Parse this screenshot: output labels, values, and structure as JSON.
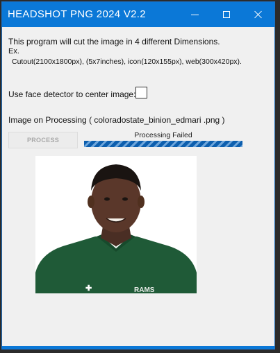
{
  "window": {
    "title": "HEADSHOT PNG 2024 V2.2",
    "accent_color": "#0b78d7",
    "controls": [
      "minimize-icon",
      "maximize-icon",
      "close-icon"
    ]
  },
  "info": {
    "line1": "This program will cut the image in 4 different Dimensions.",
    "line2": "Ex.",
    "line3": "Cutout(2100x1800px), (5x7inches), icon(120x155px), web(300x420px)."
  },
  "face_detector": {
    "label": "Use face detector to center image:",
    "checked": false
  },
  "processing": {
    "label": "Image on Processing ( coloradostate_binion_edmari .png )",
    "button_label": "PROCESS",
    "button_enabled": false,
    "status_text": "Processing Failed",
    "progress_percent": 100,
    "progress_color": "#0d5fae"
  },
  "preview": {
    "subject": "headshot portrait",
    "logo_text": "RAMS"
  }
}
